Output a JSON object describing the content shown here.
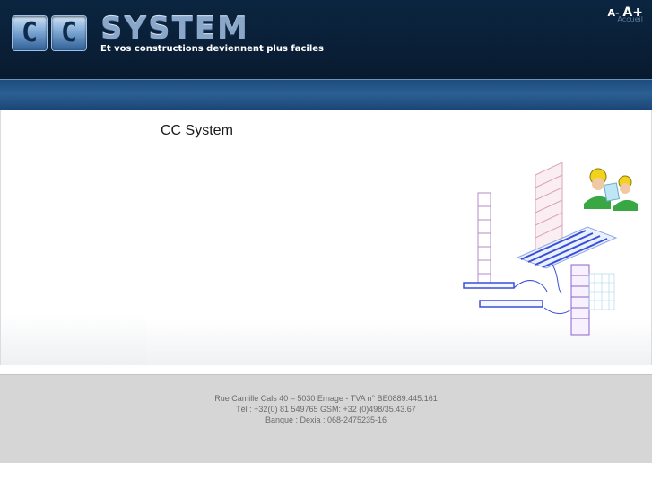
{
  "header": {
    "logo_letters": [
      "C",
      "C"
    ],
    "brand": "SYSTEM",
    "slogan": "Et vos constructions deviennent plus faciles",
    "font_smaller": "A-",
    "font_larger": "A+",
    "home_link": "Accueil"
  },
  "main": {
    "title": "CC System"
  },
  "footer": {
    "address": "Rue Camille Cals 40 – 5030 Ernage - TVA n° BE0889.445.161",
    "phone": "Tél : +32(0) 81 549765 GSM: +32 (0)498/35.43.67",
    "bank": "Banque : Dexia : 068-2475235-16"
  },
  "colors": {
    "header_bg": "#0a1f37",
    "nav_band": "#2c5f93",
    "footer_bg": "#d6d6d6"
  }
}
